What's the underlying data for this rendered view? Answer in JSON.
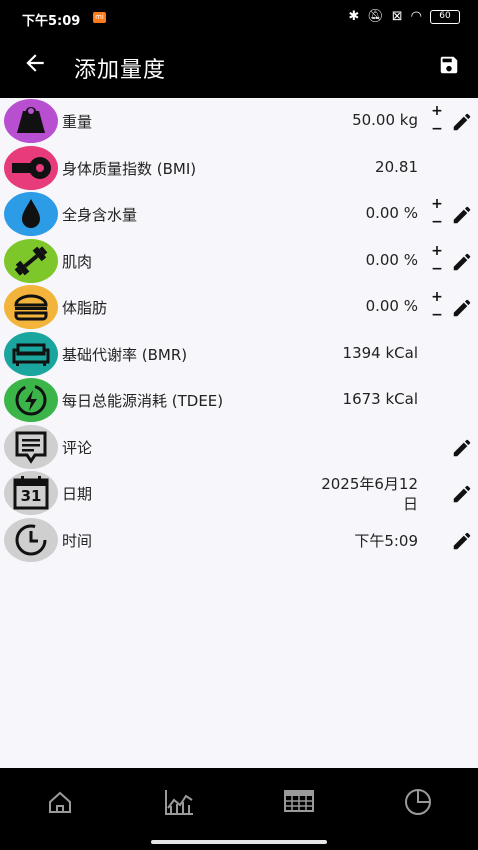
{
  "status": {
    "time": "下午5:09",
    "mi_badge": "mi",
    "battery": "60"
  },
  "appbar": {
    "title": "添加量度"
  },
  "rows": [
    {
      "label": "重量",
      "value": "50.00 kg",
      "color": "#b84fd0",
      "icon": "weight-icon"
    },
    {
      "label": "身体质量指数 (BMI)",
      "value": "20.81",
      "color": "#e83b7c",
      "icon": "tape-measure-icon"
    },
    {
      "label": "全身含水量",
      "value": "0.00 %",
      "color": "#2c9ce6",
      "icon": "water-drop-icon"
    },
    {
      "label": "肌肉",
      "value": "0.00 %",
      "color": "#7dc72b",
      "icon": "dumbbell-icon"
    },
    {
      "label": "体脂肪",
      "value": "0.00 %",
      "color": "#f2b43a",
      "icon": "burger-icon"
    },
    {
      "label": "基础代谢率 (BMR)",
      "value": "1394 kCal",
      "color": "#1aa59e",
      "icon": "sofa-icon"
    },
    {
      "label": "每日总能源消耗 (TDEE)",
      "value": "1673 kCal",
      "color": "#3bb54a",
      "icon": "energy-cycle-icon"
    },
    {
      "label": "评论",
      "value": "",
      "color": "#cfcfcf",
      "icon": "comment-icon"
    },
    {
      "label": "日期",
      "value": "2025年6月12日",
      "value_line1": "2025年6月12",
      "value_line2": "日",
      "color": "#cfcfcf",
      "icon": "calendar-icon",
      "calendar_day": "31"
    },
    {
      "label": "时间",
      "value": "下午5:09",
      "color": "#cfcfcf",
      "icon": "clock-icon"
    }
  ],
  "stepper": {
    "plus": "+",
    "minus": "−"
  },
  "nav": [
    "home-icon",
    "chart-icon",
    "table-icon",
    "pie-chart-icon"
  ]
}
